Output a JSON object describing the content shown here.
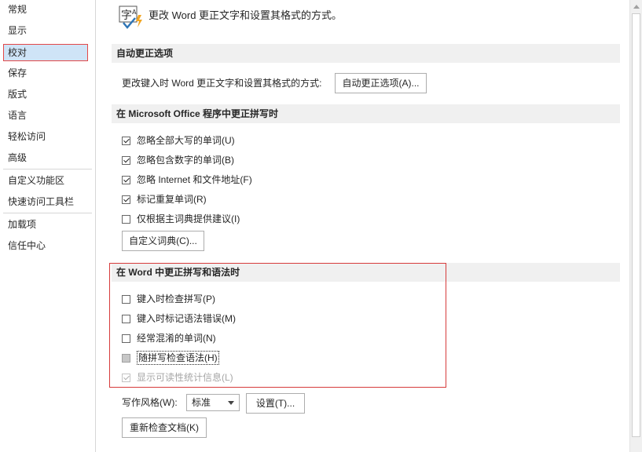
{
  "sidebar": {
    "items": [
      {
        "label": "常规"
      },
      {
        "label": "显示"
      },
      {
        "label": "校对"
      },
      {
        "label": "保存"
      },
      {
        "label": "版式"
      },
      {
        "label": "语言"
      },
      {
        "label": "轻松访问"
      },
      {
        "label": "高级"
      },
      {
        "label": "自定义功能区"
      },
      {
        "label": "快速访问工具栏"
      },
      {
        "label": "加载项"
      },
      {
        "label": "信任中心"
      }
    ],
    "selected": "校对"
  },
  "header": {
    "icon_text": "字",
    "icon_sub": "A",
    "title": "更改 Word 更正文字和设置其格式的方式。"
  },
  "autocorrect": {
    "heading": "自动更正选项",
    "description": "更改键入时 Word 更正文字和设置其格式的方式:",
    "button": "自动更正选项(A)..."
  },
  "office_spelling": {
    "heading": "在 Microsoft Office 程序中更正拼写时",
    "options": [
      {
        "label": "忽略全部大写的单词(U)",
        "checked": true
      },
      {
        "label": "忽略包含数字的单词(B)",
        "checked": true
      },
      {
        "label": "忽略 Internet 和文件地址(F)",
        "checked": true
      },
      {
        "label": "标记重复单词(R)",
        "checked": true
      },
      {
        "label": "仅根据主词典提供建议(I)",
        "checked": false
      }
    ],
    "custom_dict_button": "自定义词典(C)..."
  },
  "word_spelling": {
    "heading": "在 Word 中更正拼写和语法时",
    "options": [
      {
        "label": "键入时检查拼写(P)",
        "checked": false
      },
      {
        "label": "键入时标记语法错误(M)",
        "checked": false
      },
      {
        "label": "经常混淆的单词(N)",
        "checked": false
      },
      {
        "label": "随拼写检查语法(H)",
        "checked": false,
        "state": "indeterminate"
      },
      {
        "label": "显示可读性统计信息(L)",
        "checked": true,
        "state": "disabled"
      }
    ],
    "writing_style_label": "写作风格(W):",
    "writing_style_value": "标准",
    "settings_button": "设置(T)...",
    "recheck_button": "重新检查文档(K)"
  }
}
